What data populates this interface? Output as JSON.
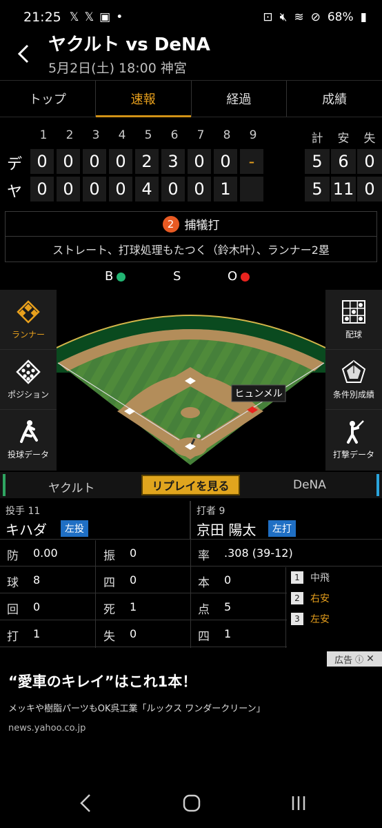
{
  "status_bar": {
    "time": "21:25",
    "battery": "68%"
  },
  "header": {
    "title": "ヤクルト vs DeNA",
    "subtitle": "5月2日(土) 18:00 神宮"
  },
  "tabs": [
    {
      "label": "トップ"
    },
    {
      "label": "速報"
    },
    {
      "label": "経過"
    },
    {
      "label": "成績"
    }
  ],
  "scoreboard": {
    "innings": [
      "1",
      "2",
      "3",
      "4",
      "5",
      "6",
      "7",
      "8",
      "9"
    ],
    "totals_header": [
      "計",
      "安",
      "失"
    ],
    "teams": [
      {
        "label": "デ",
        "innings": [
          "0",
          "0",
          "0",
          "0",
          "2",
          "3",
          "0",
          "0",
          "-"
        ],
        "totals": [
          "5",
          "6",
          "0"
        ]
      },
      {
        "label": "ヤ",
        "innings": [
          "0",
          "0",
          "0",
          "0",
          "4",
          "0",
          "0",
          "1",
          ""
        ],
        "totals": [
          "5",
          "11",
          "0"
        ]
      }
    ]
  },
  "play": {
    "outs": "2",
    "result": "捕犠打",
    "description": "ストレート、打球処理もたつく（鈴木叶）、ランナー2塁"
  },
  "count": {
    "b_label": "B",
    "s_label": "S",
    "o_label": "O",
    "ball_color": "#22b573",
    "out_color": "#e8231e"
  },
  "side_left": [
    {
      "label": "ランナー",
      "icon": "runner-diamond-icon"
    },
    {
      "label": "ポジション",
      "icon": "position-icon"
    },
    {
      "label": "投球データ",
      "icon": "pitcher-icon"
    }
  ],
  "side_right": [
    {
      "label": "配球",
      "icon": "pitch-grid-icon"
    },
    {
      "label": "条件別成績",
      "icon": "radar-chart-icon"
    },
    {
      "label": "打撃データ",
      "icon": "batter-icon"
    }
  ],
  "field": {
    "runner_label": "ヒュンメル"
  },
  "toggle": {
    "left_team": "ヤクルト",
    "replay": "リプレイを見る",
    "right_team": "DeNA"
  },
  "pitcher": {
    "role": "投手 11",
    "name": "キハダ",
    "hand": "左投",
    "stats": [
      {
        "label": "防",
        "value": "0.00"
      },
      {
        "label": "振",
        "value": "0"
      },
      {
        "label": "球",
        "value": "8"
      },
      {
        "label": "四",
        "value": "0"
      },
      {
        "label": "回",
        "value": "0"
      },
      {
        "label": "死",
        "value": "1"
      },
      {
        "label": "打",
        "value": "1"
      },
      {
        "label": "失",
        "value": "0"
      }
    ]
  },
  "batter": {
    "role": "打者 9",
    "name": "京田 陽太",
    "hand": "左打",
    "stats": [
      {
        "label": "率",
        "value": ".308 (39-12)"
      },
      {
        "label": "本",
        "value": "0"
      },
      {
        "label": "点",
        "value": "5"
      },
      {
        "label": "四",
        "value": "1"
      }
    ],
    "results": [
      {
        "num": "1",
        "text": "中飛",
        "color": "#cccccc"
      },
      {
        "num": "2",
        "text": "右安",
        "color": "#e8a01c"
      },
      {
        "num": "3",
        "text": "左安",
        "color": "#e8a01c"
      }
    ]
  },
  "ad": {
    "tag": "広告",
    "title": "“愛車のキレイ”はこれ1本！",
    "text": "メッキや樹脂パーツもOK呉工業「ルックス ワンダークリーン」",
    "url": "news.yahoo.co.jp"
  }
}
